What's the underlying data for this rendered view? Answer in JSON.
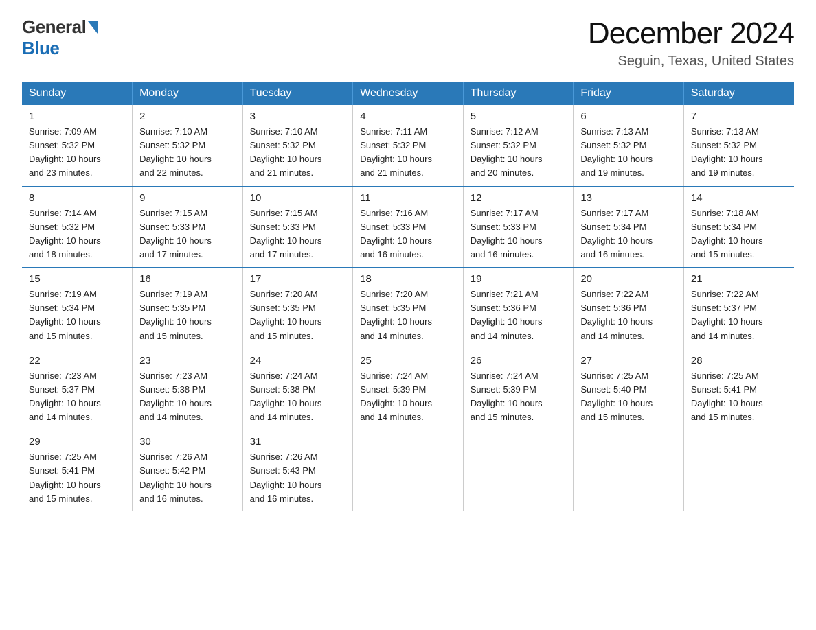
{
  "logo": {
    "general": "General",
    "blue": "Blue"
  },
  "title": {
    "month": "December 2024",
    "location": "Seguin, Texas, United States"
  },
  "weekdays": [
    "Sunday",
    "Monday",
    "Tuesday",
    "Wednesday",
    "Thursday",
    "Friday",
    "Saturday"
  ],
  "weeks": [
    [
      {
        "day": "1",
        "sunrise": "7:09 AM",
        "sunset": "5:32 PM",
        "daylight": "10 hours and 23 minutes."
      },
      {
        "day": "2",
        "sunrise": "7:10 AM",
        "sunset": "5:32 PM",
        "daylight": "10 hours and 22 minutes."
      },
      {
        "day": "3",
        "sunrise": "7:10 AM",
        "sunset": "5:32 PM",
        "daylight": "10 hours and 21 minutes."
      },
      {
        "day": "4",
        "sunrise": "7:11 AM",
        "sunset": "5:32 PM",
        "daylight": "10 hours and 21 minutes."
      },
      {
        "day": "5",
        "sunrise": "7:12 AM",
        "sunset": "5:32 PM",
        "daylight": "10 hours and 20 minutes."
      },
      {
        "day": "6",
        "sunrise": "7:13 AM",
        "sunset": "5:32 PM",
        "daylight": "10 hours and 19 minutes."
      },
      {
        "day": "7",
        "sunrise": "7:13 AM",
        "sunset": "5:32 PM",
        "daylight": "10 hours and 19 minutes."
      }
    ],
    [
      {
        "day": "8",
        "sunrise": "7:14 AM",
        "sunset": "5:32 PM",
        "daylight": "10 hours and 18 minutes."
      },
      {
        "day": "9",
        "sunrise": "7:15 AM",
        "sunset": "5:33 PM",
        "daylight": "10 hours and 17 minutes."
      },
      {
        "day": "10",
        "sunrise": "7:15 AM",
        "sunset": "5:33 PM",
        "daylight": "10 hours and 17 minutes."
      },
      {
        "day": "11",
        "sunrise": "7:16 AM",
        "sunset": "5:33 PM",
        "daylight": "10 hours and 16 minutes."
      },
      {
        "day": "12",
        "sunrise": "7:17 AM",
        "sunset": "5:33 PM",
        "daylight": "10 hours and 16 minutes."
      },
      {
        "day": "13",
        "sunrise": "7:17 AM",
        "sunset": "5:34 PM",
        "daylight": "10 hours and 16 minutes."
      },
      {
        "day": "14",
        "sunrise": "7:18 AM",
        "sunset": "5:34 PM",
        "daylight": "10 hours and 15 minutes."
      }
    ],
    [
      {
        "day": "15",
        "sunrise": "7:19 AM",
        "sunset": "5:34 PM",
        "daylight": "10 hours and 15 minutes."
      },
      {
        "day": "16",
        "sunrise": "7:19 AM",
        "sunset": "5:35 PM",
        "daylight": "10 hours and 15 minutes."
      },
      {
        "day": "17",
        "sunrise": "7:20 AM",
        "sunset": "5:35 PM",
        "daylight": "10 hours and 15 minutes."
      },
      {
        "day": "18",
        "sunrise": "7:20 AM",
        "sunset": "5:35 PM",
        "daylight": "10 hours and 14 minutes."
      },
      {
        "day": "19",
        "sunrise": "7:21 AM",
        "sunset": "5:36 PM",
        "daylight": "10 hours and 14 minutes."
      },
      {
        "day": "20",
        "sunrise": "7:22 AM",
        "sunset": "5:36 PM",
        "daylight": "10 hours and 14 minutes."
      },
      {
        "day": "21",
        "sunrise": "7:22 AM",
        "sunset": "5:37 PM",
        "daylight": "10 hours and 14 minutes."
      }
    ],
    [
      {
        "day": "22",
        "sunrise": "7:23 AM",
        "sunset": "5:37 PM",
        "daylight": "10 hours and 14 minutes."
      },
      {
        "day": "23",
        "sunrise": "7:23 AM",
        "sunset": "5:38 PM",
        "daylight": "10 hours and 14 minutes."
      },
      {
        "day": "24",
        "sunrise": "7:24 AM",
        "sunset": "5:38 PM",
        "daylight": "10 hours and 14 minutes."
      },
      {
        "day": "25",
        "sunrise": "7:24 AM",
        "sunset": "5:39 PM",
        "daylight": "10 hours and 14 minutes."
      },
      {
        "day": "26",
        "sunrise": "7:24 AM",
        "sunset": "5:39 PM",
        "daylight": "10 hours and 15 minutes."
      },
      {
        "day": "27",
        "sunrise": "7:25 AM",
        "sunset": "5:40 PM",
        "daylight": "10 hours and 15 minutes."
      },
      {
        "day": "28",
        "sunrise": "7:25 AM",
        "sunset": "5:41 PM",
        "daylight": "10 hours and 15 minutes."
      }
    ],
    [
      {
        "day": "29",
        "sunrise": "7:25 AM",
        "sunset": "5:41 PM",
        "daylight": "10 hours and 15 minutes."
      },
      {
        "day": "30",
        "sunrise": "7:26 AM",
        "sunset": "5:42 PM",
        "daylight": "10 hours and 16 minutes."
      },
      {
        "day": "31",
        "sunrise": "7:26 AM",
        "sunset": "5:43 PM",
        "daylight": "10 hours and 16 minutes."
      },
      null,
      null,
      null,
      null
    ]
  ],
  "labels": {
    "sunrise": "Sunrise:",
    "sunset": "Sunset:",
    "daylight": "Daylight:"
  }
}
